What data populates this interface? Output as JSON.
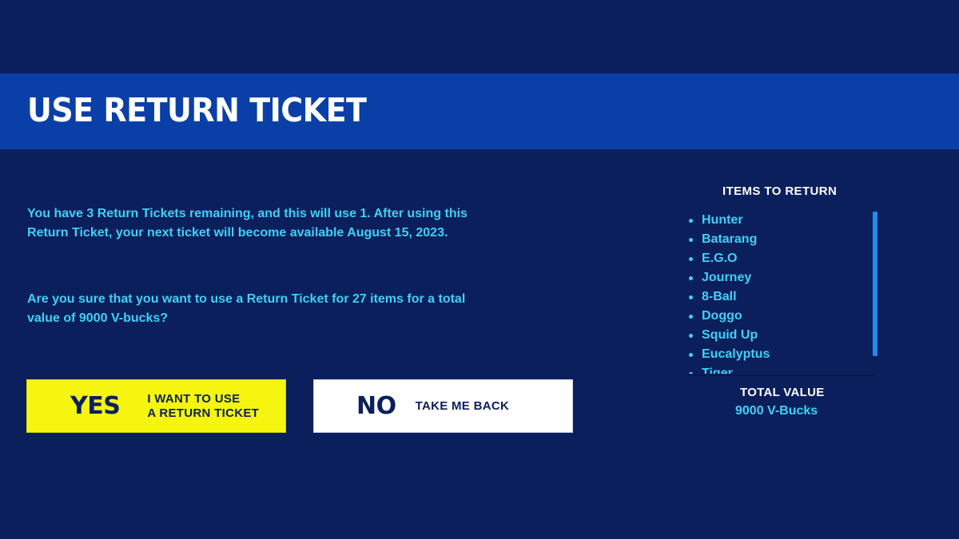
{
  "dialog": {
    "title": "USE RETURN TICKET",
    "message_1": "You have 3 Return Tickets remaining, and this will use 1. After using this Return Ticket, your next ticket will become available August 15, 2023.",
    "message_2": "Are you sure that you want to use a Return Ticket for 27 items for a total value of 9000 V-bucks?"
  },
  "buttons": {
    "yes": {
      "big": "YES",
      "line1": "I WANT TO USE",
      "line2": "A RETURN TICKET"
    },
    "no": {
      "big": "NO",
      "small": "TAKE ME BACK"
    }
  },
  "side_panel": {
    "title": "ITEMS TO RETURN",
    "items": [
      "Hunter",
      "Batarang",
      "E.G.O",
      "Journey",
      "8-Ball",
      "Doggo",
      "Squid Up",
      "Eucalyptus",
      "Tiger"
    ],
    "total_label": "TOTAL VALUE",
    "total_value": "9000 V-Bucks"
  },
  "colors": {
    "background": "#0b1f5c",
    "title_bar": "#0a3fa8",
    "accent_text": "#3fd0f5",
    "yes_button": "#f5f50f",
    "no_button": "#ffffff",
    "scrollbar": "#1c8ef0"
  }
}
